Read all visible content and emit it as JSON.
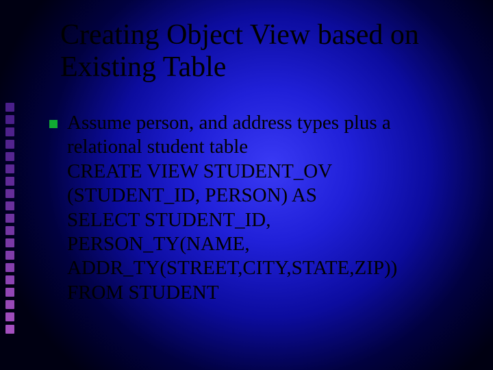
{
  "slide": {
    "title": "Creating Object View based on Existing Table",
    "bullet_text": "Assume person, and address types plus a relational student table",
    "body_lines": [
      "CREATE VIEW STUDENT_OV",
      "(STUDENT_ID, PERSON) AS",
      " SELECT STUDENT_ID,",
      "PERSON_TY(NAME,",
      "ADDR_TY(STREET,CITY,STATE,ZIP))",
      "FROM STUDENT"
    ],
    "decoration": {
      "square_colors": [
        "#4a1f8a",
        "#4a1f8a",
        "#4e218c",
        "#52238e",
        "#562591",
        "#5b2894",
        "#602a97",
        "#652d9a",
        "#6a309d",
        "#6f33a0",
        "#7436a3",
        "#7a39a6",
        "#803caa",
        "#863fae",
        "#8c43b2",
        "#9246b5",
        "#9849b8",
        "#9e4cbb",
        "#a44fbf"
      ]
    }
  }
}
